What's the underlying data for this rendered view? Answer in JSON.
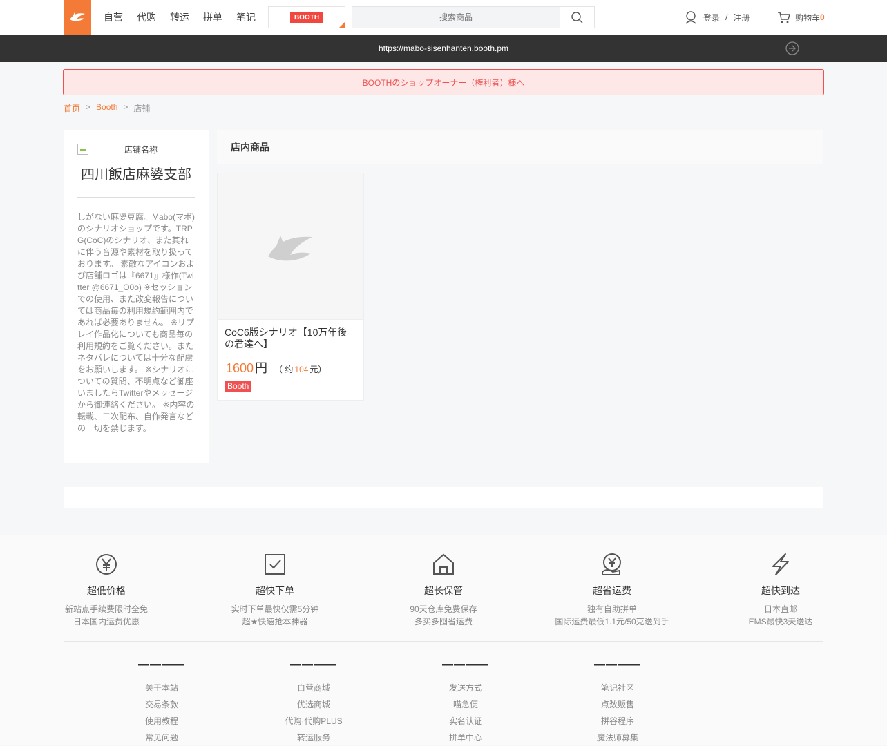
{
  "nav": {
    "links": [
      "自营",
      "代购",
      "转运",
      "拼单",
      "笔记"
    ],
    "booth_logo": "BOOTH",
    "search_placeholder": "搜索商品",
    "login": "登录",
    "sep": "/",
    "register": "注册",
    "cart_label": "购物车",
    "cart_count": "0"
  },
  "urlbar": {
    "url": "https://mabo-sisenhanten.booth.pm"
  },
  "owner_banner": "BOOTHのショップオーナー（権利者）様へ",
  "breadcrumb": [
    "首页",
    ">",
    "Booth",
    ">",
    "店铺"
  ],
  "shop": {
    "image_alt": "店铺名称",
    "name": "四川飯店麻婆支部",
    "description": "しがない麻婆豆腐。Mabo(マボ)のシナリオショップです。TRPG(CoC)のシナリオ、また其れに伴う音源や素材を取り扱っております。 素敵なアイコンおよび店舗ロゴは『6671』様作(Twitter @6671_O0o) ※セッションでの使用、また改変報告については商品毎の利用規約範囲内であれば必要ありません。 ※リプレイ作品化についても商品毎の利用規約をご覧ください。またネタバレについては十分な配慮をお願いします。 ※シナリオについての質問、不明点など御座いましたらTwitterやメッセージから御連絡ください。 ※内容の転載、二次配布、自作発言などの一切を禁じます。"
  },
  "goods": {
    "heading": "店内商品",
    "items": [
      {
        "title": "CoC6版シナリオ【10万年後の君達へ】",
        "price": "1600",
        "currency": "円",
        "approx_prefix": "（ 约",
        "approx_value": "104",
        "approx_suffix": "元）",
        "tag": "Booth"
      }
    ]
  },
  "footer": {
    "features": [
      {
        "icon": "yen-circle-icon",
        "title": "超低价格",
        "lines": [
          "新站点手续费限时全免",
          "日本国内运费优惠"
        ]
      },
      {
        "icon": "checkbox-icon",
        "title": "超快下单",
        "lines": [
          "实时下单最快仅需5分钟",
          "超★快速抢本神器"
        ]
      },
      {
        "icon": "house-icon",
        "title": "超长保管",
        "lines": [
          "90天仓库免费保存",
          "多买多囤省运费"
        ]
      },
      {
        "icon": "money-hand-icon",
        "title": "超省运费",
        "lines": [
          "独有自助拼单",
          "国际运费最低1.1元/50克送到手"
        ]
      },
      {
        "icon": "lightning-icon",
        "title": "超快到达",
        "lines": [
          "日本直邮",
          "EMS最快3天送达"
        ]
      }
    ],
    "columns": [
      {
        "heading": "————",
        "links": [
          "关于本站",
          "交易条款",
          "使用教程",
          "常见问题"
        ]
      },
      {
        "heading": "————",
        "links": [
          "自营商城",
          "优选商城",
          "代购·代购PLUS",
          "转运服务"
        ]
      },
      {
        "heading": "————",
        "links": [
          "发送方式",
          "喵急便",
          "实名认证",
          "拼单中心"
        ]
      },
      {
        "heading": "————",
        "links": [
          "笔记社区",
          "点数贩售",
          "拼谷程序",
          "魔法师募集"
        ]
      }
    ]
  },
  "colors": {
    "accent": "#f37b37",
    "danger": "#f05050",
    "urlbar": "#333333"
  }
}
